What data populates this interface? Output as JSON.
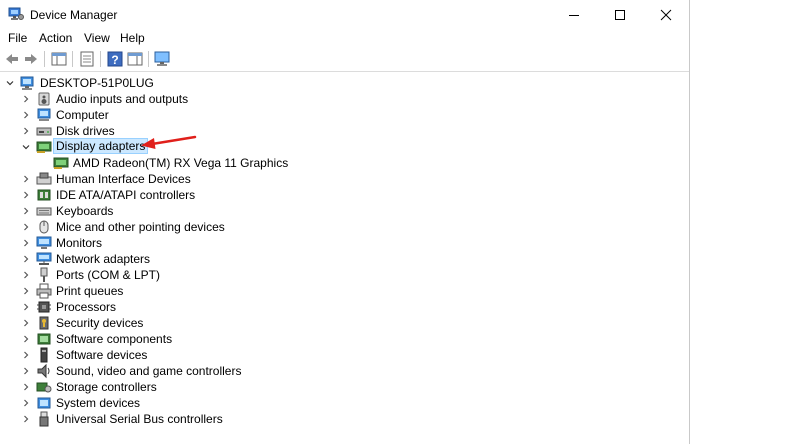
{
  "window": {
    "title": "Device Manager",
    "controls": [
      "minimize",
      "maximize",
      "close"
    ]
  },
  "menu": [
    "File",
    "Action",
    "View",
    "Help"
  ],
  "toolbar": {
    "buttons": [
      "back-icon",
      "forward-icon",
      "properties-icon",
      "show-hide-console-tree-icon",
      "help-icon",
      "action-pane-icon",
      "scan-hardware-icon"
    ]
  },
  "tree": {
    "root": "DESKTOP-51P0LUG",
    "categories": [
      {
        "label": "Audio inputs and outputs",
        "icon": "speaker-icon"
      },
      {
        "label": "Computer",
        "icon": "computer-icon"
      },
      {
        "label": "Disk drives",
        "icon": "disk-drive-icon"
      },
      {
        "label": "Display adapters",
        "icon": "display-adapter-icon",
        "expanded": true,
        "selected": true,
        "children": [
          "AMD Radeon(TM) RX Vega 11 Graphics"
        ]
      },
      {
        "label": "Human Interface Devices",
        "icon": "hid-icon"
      },
      {
        "label": "IDE ATA/ATAPI controllers",
        "icon": "ide-controller-icon"
      },
      {
        "label": "Keyboards",
        "icon": "keyboard-icon"
      },
      {
        "label": "Mice and other pointing devices",
        "icon": "mouse-icon"
      },
      {
        "label": "Monitors",
        "icon": "monitor-icon"
      },
      {
        "label": "Network adapters",
        "icon": "network-adapter-icon"
      },
      {
        "label": "Ports (COM & LPT)",
        "icon": "port-icon"
      },
      {
        "label": "Print queues",
        "icon": "printer-icon"
      },
      {
        "label": "Processors",
        "icon": "processor-icon"
      },
      {
        "label": "Security devices",
        "icon": "security-device-icon"
      },
      {
        "label": "Software components",
        "icon": "software-component-icon"
      },
      {
        "label": "Software devices",
        "icon": "software-device-icon"
      },
      {
        "label": "Sound, video and game controllers",
        "icon": "sound-controller-icon"
      },
      {
        "label": "Storage controllers",
        "icon": "storage-controller-icon"
      },
      {
        "label": "System devices",
        "icon": "system-device-icon"
      },
      {
        "label": "Universal Serial Bus controllers",
        "icon": "usb-icon"
      }
    ]
  },
  "annotation": {
    "type": "red-arrow",
    "points_to": "Display adapters"
  },
  "colors": {
    "selection": "#cce8ff",
    "selection_border": "#99d1ff",
    "arrow": "#e0201b",
    "folder": "#e8b931"
  }
}
